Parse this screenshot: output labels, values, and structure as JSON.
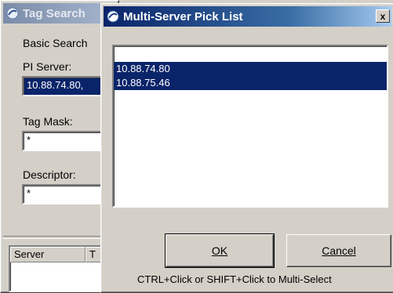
{
  "back_window": {
    "title": "Tag Search",
    "section_label": "Basic Search",
    "pi_server_label": "PI Server:",
    "pi_server_value": "10.88.74.80,",
    "tag_mask_label": "Tag Mask:",
    "tag_mask_value": "*",
    "descriptor_label": "Descriptor:",
    "descriptor_value": "*",
    "results_columns": [
      "Server",
      "T"
    ]
  },
  "dialog": {
    "title": "Multi-Server Pick List",
    "close_glyph": "x",
    "servers": [
      {
        "name": "10.88.74.80",
        "selected": true
      },
      {
        "name": "10.88.75.46",
        "selected": true
      }
    ],
    "ok_label": "OK",
    "cancel_label": "Cancel",
    "hint": "CTRL+Click or SHIFT+Click to Multi-Select"
  },
  "colors": {
    "selection": "#0a246a",
    "face": "#d4d0c8"
  }
}
